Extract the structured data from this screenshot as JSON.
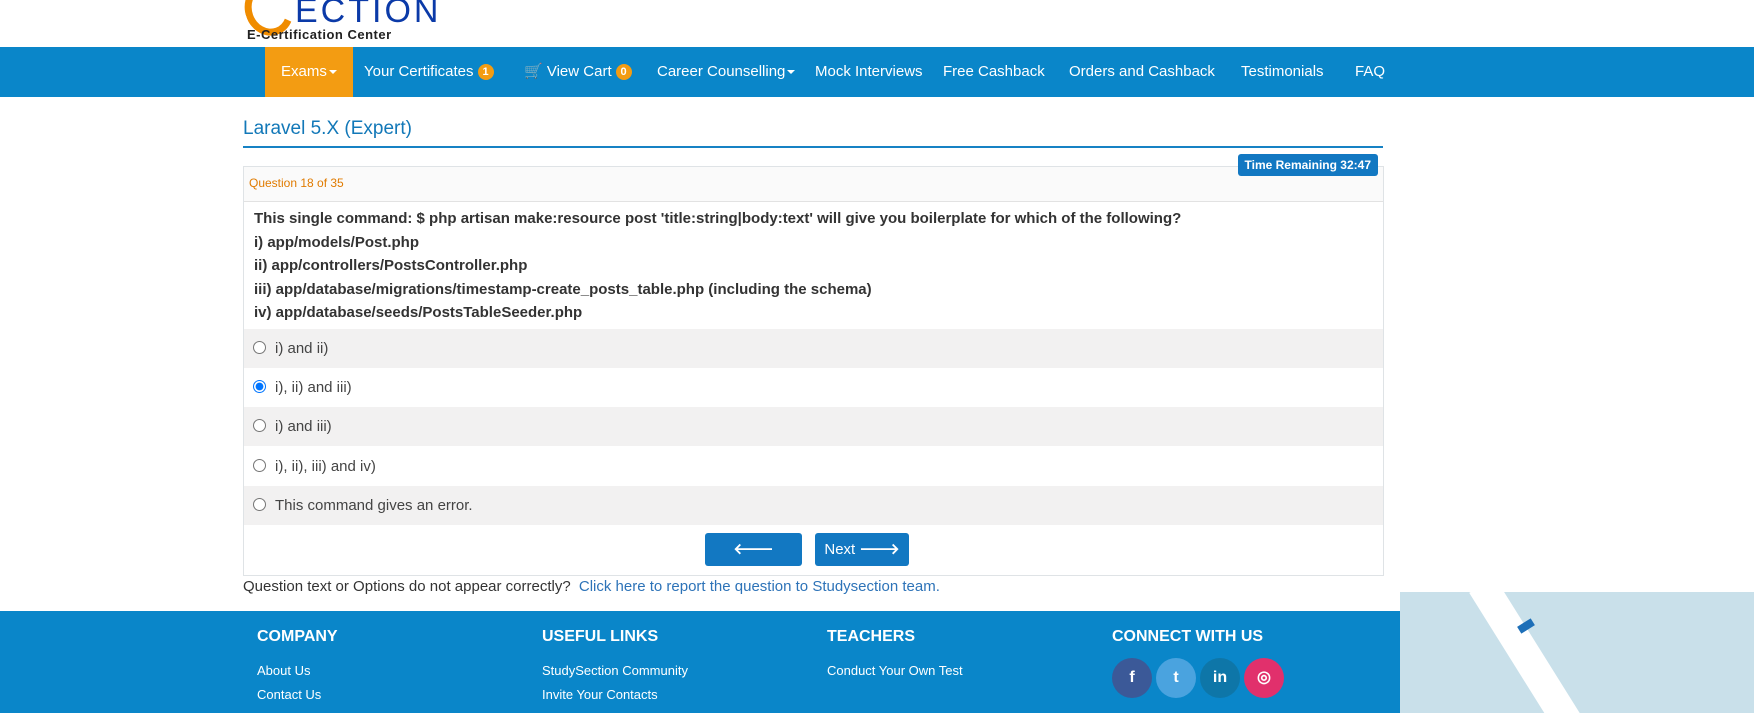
{
  "logo": {
    "word": "ECTION",
    "subtitle": "E-Certification Center"
  },
  "nav": {
    "exams": "Exams",
    "certificates": "Your Certificates",
    "certificates_count": "1",
    "cart": "View Cart",
    "cart_count": "0",
    "career": "Career Counselling",
    "mock": "Mock Interviews",
    "cashback": "Free Cashback",
    "orders": "Orders and Cashback",
    "testimonials": "Testimonials",
    "faq": "FAQ"
  },
  "exam": {
    "title": "Laravel 5.X (Expert)",
    "question_count": "Question 18 of 35",
    "timer": "Time Remaining 32:47"
  },
  "question": {
    "lines": [
      "This single command: $ php artisan make:resource post 'title:string|body:text' will give you boilerplate for which of the following?",
      "i) app/models/Post.php",
      "ii) app/controllers/PostsController.php",
      "iii) app/database/migrations/timestamp-create_posts_table.php (including the schema)",
      "iv) app/database/seeds/PostsTableSeeder.php"
    ]
  },
  "options": [
    {
      "label": "i) and ii)",
      "selected": false
    },
    {
      "label": "i), ii) and iii)",
      "selected": true
    },
    {
      "label": "i) and iii)",
      "selected": false
    },
    {
      "label": "i), ii), iii) and iv)",
      "selected": false
    },
    {
      "label": "This command gives an error.",
      "selected": false
    }
  ],
  "buttons": {
    "previous": "Previous",
    "next": "Next"
  },
  "report": {
    "text": "Question text or Options do not appear correctly?",
    "link": "Click here to report the question to Studysection team."
  },
  "footer": {
    "company": {
      "heading": "COMPANY",
      "links": [
        "About Us",
        "Contact Us"
      ]
    },
    "useful": {
      "heading": "USEFUL LINKS",
      "links": [
        "StudySection Community",
        "Invite Your Contacts"
      ]
    },
    "teachers": {
      "heading": "TEACHERS",
      "links": [
        "Conduct Your Own Test"
      ]
    },
    "connect": {
      "heading": "CONNECT WITH US"
    }
  },
  "social": [
    {
      "name": "facebook-icon",
      "glyph": "f",
      "color": "#3b5998"
    },
    {
      "name": "twitter-icon",
      "glyph": "t",
      "color": "#4aa3df"
    },
    {
      "name": "linkedin-icon",
      "glyph": "in",
      "color": "#0e76a8"
    },
    {
      "name": "instagram-icon",
      "glyph": "◎",
      "color": "#e1306c"
    }
  ],
  "colors": {
    "primary": "#0a86c9",
    "accent": "#f39c12",
    "title": "#1278b8"
  }
}
